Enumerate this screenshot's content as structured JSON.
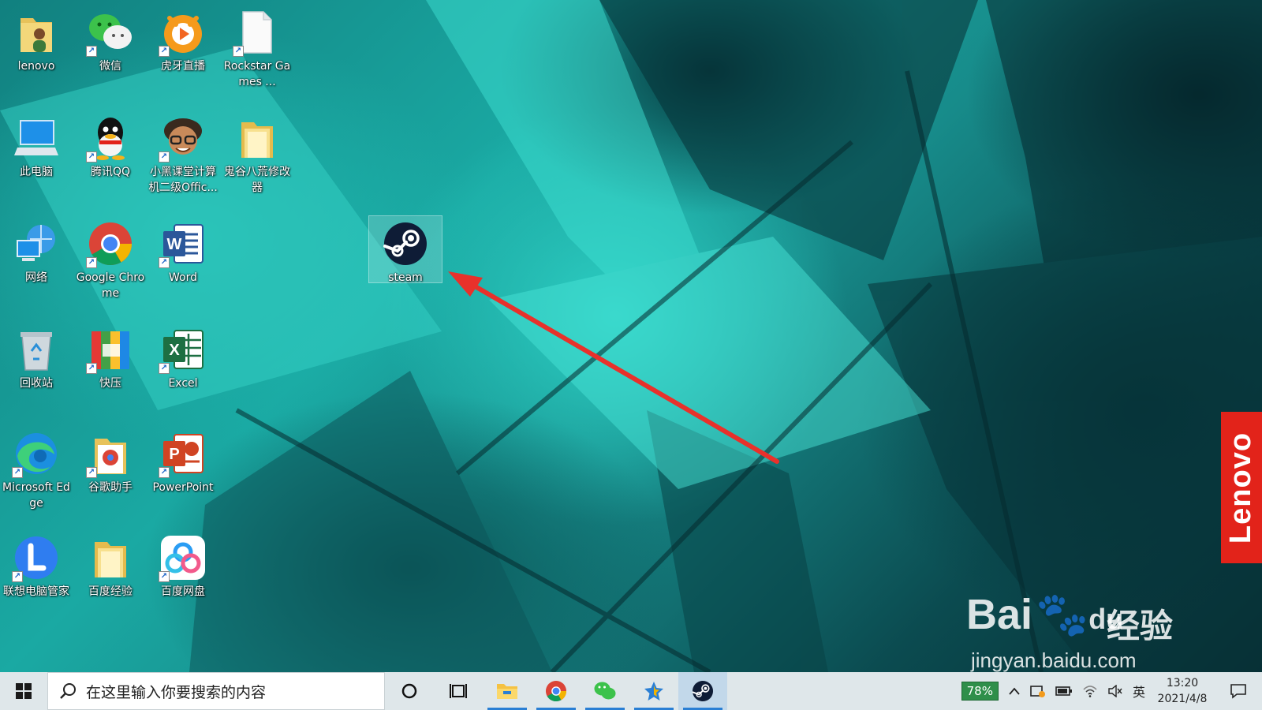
{
  "desktop": {
    "icons": [
      {
        "label": "lenovo",
        "icon": "user-folder-icon"
      },
      {
        "label": "微信",
        "icon": "wechat-icon"
      },
      {
        "label": "虎牙直播",
        "icon": "huya-icon"
      },
      {
        "label": "Rockstar Games ...",
        "icon": "document-icon"
      },
      {
        "label": "此电脑",
        "icon": "computer-icon"
      },
      {
        "label": "腾讯QQ",
        "icon": "qq-icon"
      },
      {
        "label": "小黑课堂计算机二级Offic...",
        "icon": "cartoon-avatar-icon"
      },
      {
        "label": "鬼谷八荒修改器",
        "icon": "folder-icon"
      },
      {
        "label": "网络",
        "icon": "network-icon"
      },
      {
        "label": "Google Chrome",
        "icon": "chrome-icon"
      },
      {
        "label": "Word",
        "icon": "word-icon"
      },
      {
        "label": "steam",
        "icon": "steam-icon"
      },
      {
        "label": "回收站",
        "icon": "recycle-bin-icon"
      },
      {
        "label": "快压",
        "icon": "kuaiya-icon"
      },
      {
        "label": "Excel",
        "icon": "excel-icon"
      },
      {
        "label": "Microsoft Edge",
        "icon": "edge-icon"
      },
      {
        "label": "谷歌助手",
        "icon": "google-helper-icon"
      },
      {
        "label": "PowerPoint",
        "icon": "powerpoint-icon"
      },
      {
        "label": "联想电脑管家",
        "icon": "lenovo-manager-icon"
      },
      {
        "label": "百度经验",
        "icon": "folder-icon"
      },
      {
        "label": "百度网盘",
        "icon": "baidu-netdisk-icon"
      }
    ],
    "selected_icon": "steam"
  },
  "watermark": {
    "brand": "Lenovo",
    "baidu": "Bai",
    "baidu_du": "du",
    "jingyan": "经验",
    "url": "jingyan.baidu.com"
  },
  "taskbar": {
    "search_placeholder": "在这里输入你要搜索的内容",
    "pinned": [
      "file-explorer-icon",
      "chrome-icon",
      "wechat-icon",
      "star-app-icon",
      "steam-icon"
    ],
    "tray": {
      "battery": "78%",
      "input_method": "英",
      "time": "13:20",
      "date": "2021/4/8"
    }
  },
  "colors": {
    "accent_arrow": "#e8312b",
    "taskbar": "#dfe7ea",
    "lenovo_red": "#e2231a"
  }
}
